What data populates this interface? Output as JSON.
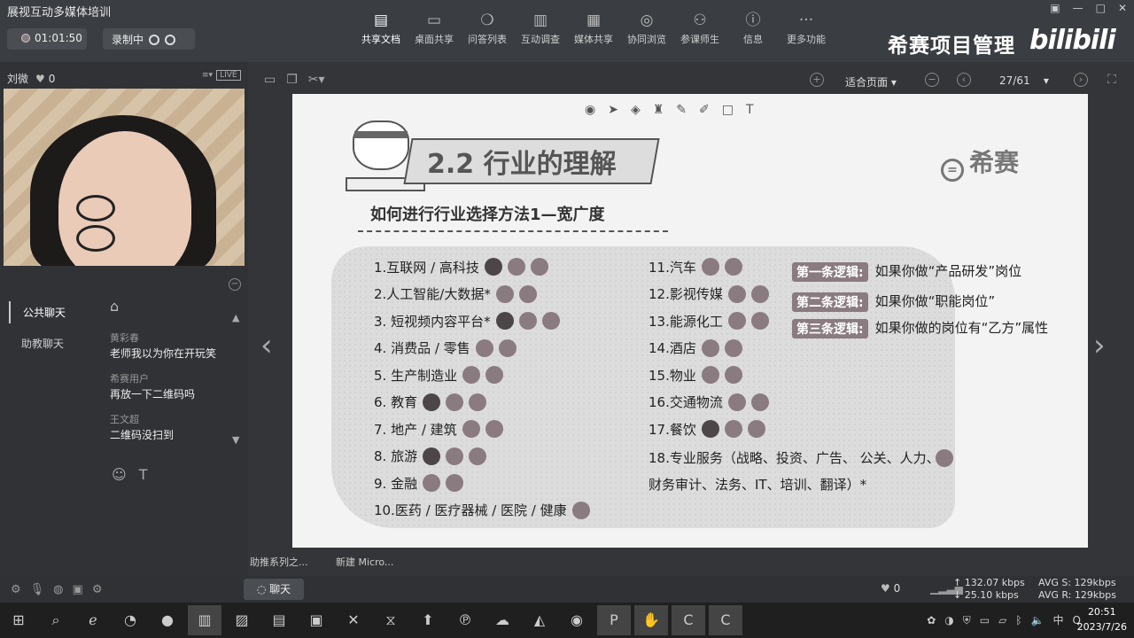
{
  "app": {
    "title": "展视互动多媒体培训",
    "timer": "01:01:50",
    "recording_label": "录制中",
    "brand": "希赛项目管理",
    "bili": "bilibili"
  },
  "toolbar": {
    "items": [
      {
        "label": "共享文档",
        "icon": "document-icon"
      },
      {
        "label": "桌面共享",
        "icon": "screen-share-icon"
      },
      {
        "label": "问答列表",
        "icon": "qa-icon"
      },
      {
        "label": "互动调查",
        "icon": "survey-icon"
      },
      {
        "label": "媒体共享",
        "icon": "media-icon"
      },
      {
        "label": "协同浏览",
        "icon": "browse-icon"
      },
      {
        "label": "参课师生",
        "icon": "people-icon"
      },
      {
        "label": "信息",
        "icon": "info-icon"
      },
      {
        "label": "更多功能",
        "icon": "more-icon"
      }
    ]
  },
  "left": {
    "user": "刘微",
    "likes": "0",
    "live": "LIVE",
    "tabs": [
      "公共聊天",
      "助教聊天"
    ],
    "messages": [
      {
        "name": "黄彩春",
        "text": "老师我以为你在开玩笑"
      },
      {
        "name": "希赛用户",
        "text": "再放一下二维码吗"
      },
      {
        "name": "王文超",
        "text": "二维码没扫到"
      }
    ]
  },
  "viewer": {
    "fit": "适合页面",
    "page": "27/61"
  },
  "slide": {
    "title": "2.2 行业的理解",
    "logo": "希赛",
    "subtitle": "如何进行行业选择方法1—宽广度",
    "col1": [
      {
        "label": "1.互联网 / 高科技",
        "dots": 3,
        "dark": true
      },
      {
        "label": "2.人工智能/大数据*",
        "dots": 2,
        "dark": false
      },
      {
        "label": "3. 短视频内容平台*",
        "dots": 3,
        "dark": true
      },
      {
        "label": "4. 消费品 / 零售",
        "dots": 2,
        "dark": false
      },
      {
        "label": "5. 生产制造业",
        "dots": 2,
        "dark": false
      },
      {
        "label": "6. 教育",
        "dots": 3,
        "dark": true
      },
      {
        "label": "7. 地产 / 建筑",
        "dots": 2,
        "dark": false
      },
      {
        "label": "8. 旅游",
        "dots": 3,
        "dark": true
      },
      {
        "label": "9. 金融",
        "dots": 2,
        "dark": false
      },
      {
        "label": "10.医药 / 医疗器械 / 医院 / 健康",
        "dots": 1,
        "dark": false
      }
    ],
    "col2": [
      {
        "label": "11.汽车",
        "dots": 2,
        "dark": false
      },
      {
        "label": "12.影视传媒",
        "dots": 2,
        "dark": false
      },
      {
        "label": "13.能源化工",
        "dots": 2,
        "dark": false
      },
      {
        "label": "14.酒店",
        "dots": 2,
        "dark": false
      },
      {
        "label": "15.物业",
        "dots": 2,
        "dark": false
      },
      {
        "label": "16.交通物流",
        "dots": 2,
        "dark": false
      },
      {
        "label": "17.餐饮",
        "dots": 3,
        "dark": true
      }
    ],
    "item18": "18.专业服务（战略、投资、广告、 公关、人力、财务审计、法务、IT、培训、翻译）*",
    "logic": [
      {
        "tag": "第一条逻辑:",
        "text": "如果你做“产品研发”岗位"
      },
      {
        "tag": "第二条逻辑:",
        "text": "如果你做“职能岗位”"
      },
      {
        "tag": "第三条逻辑:",
        "text": "如果你做的岗位有“乙方”属性"
      }
    ]
  },
  "notes": [
    "助推系列之...",
    "新建 Micro..."
  ],
  "status": {
    "chat_btn": "聊天",
    "likes": "0",
    "up_rate": "132.07 kbps",
    "down_rate": "25.10 kbps",
    "avg_s": "AVG S: 129kbps",
    "avg_r": "AVG R: 129kbps"
  },
  "taskbar": {
    "time": "20:51",
    "date": "2023/7/26",
    "ime": "中"
  }
}
